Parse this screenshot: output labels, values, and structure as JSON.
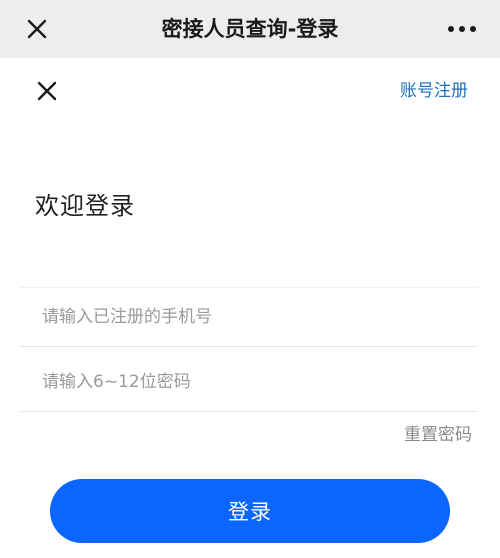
{
  "nav": {
    "title": "密接人员查询-登录",
    "close_icon": "close-icon",
    "more_icon": "more-dots-icon"
  },
  "header": {
    "close_icon": "close-icon",
    "register_label": "账号注册"
  },
  "welcome_text": "欢迎登录",
  "form": {
    "phone": {
      "placeholder": "请输入已注册的手机号",
      "value": ""
    },
    "password": {
      "placeholder": "请输入6~12位密码",
      "value": ""
    }
  },
  "reset_label": "重置密码",
  "login_label": "登录",
  "colors": {
    "nav_bg": "#ededed",
    "link_blue": "#1e6fb8",
    "button_blue": "#0a66ff",
    "muted_text": "#9a9a9a"
  }
}
